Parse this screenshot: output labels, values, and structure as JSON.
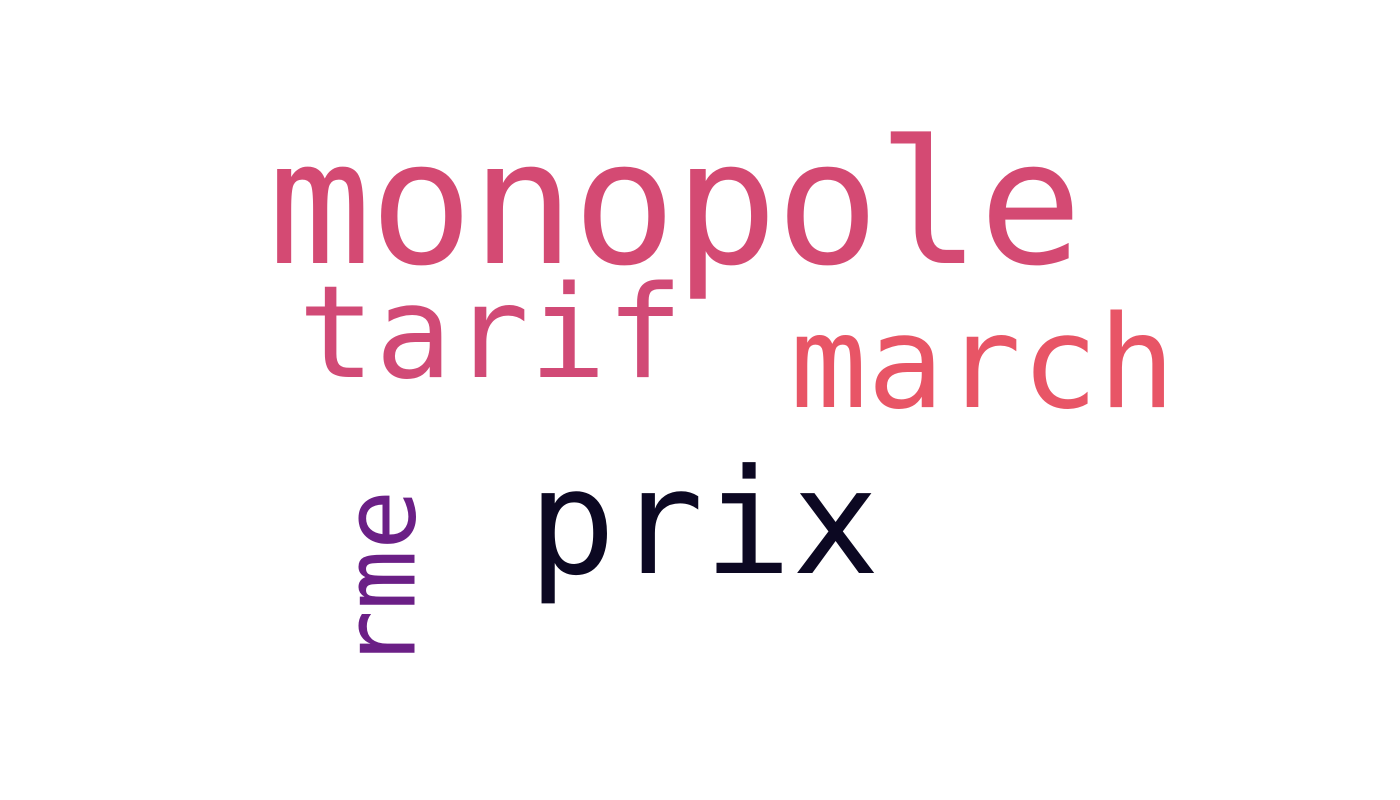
{
  "cloud": {
    "words": [
      {
        "text": "monopole",
        "color": "#d44a73"
      },
      {
        "text": "tarif",
        "color": "#d14a76"
      },
      {
        "text": "march",
        "color": "#e85566"
      },
      {
        "text": "prix",
        "color": "#0c0822"
      },
      {
        "text": "rme",
        "color": "#6b1f86"
      }
    ]
  }
}
